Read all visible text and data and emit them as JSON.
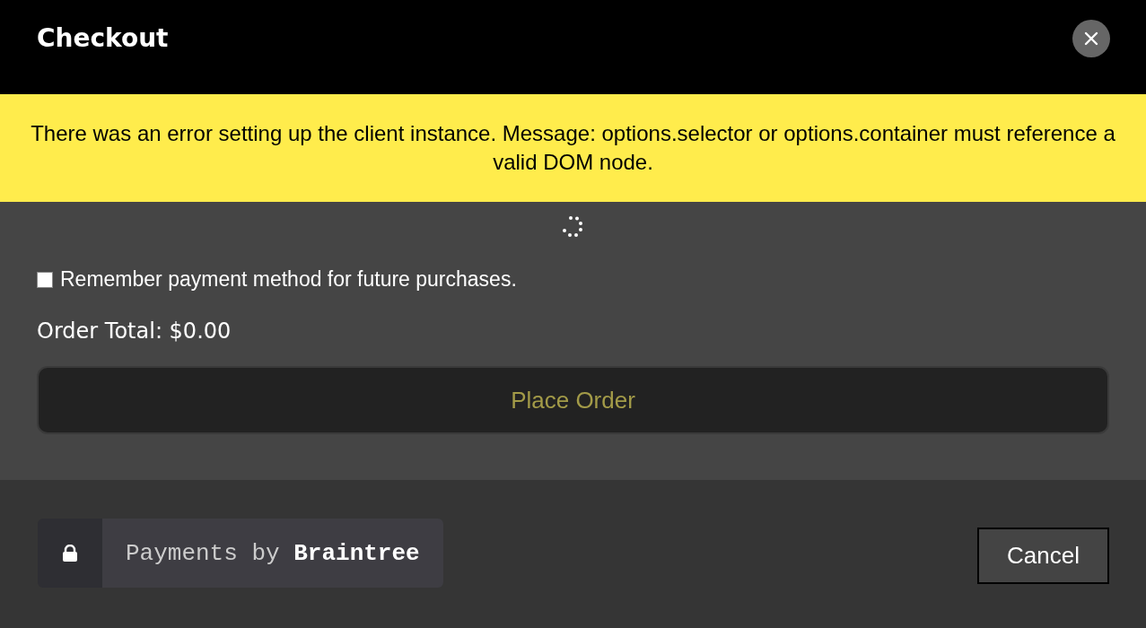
{
  "window": {
    "title": "Checkout"
  },
  "alert": {
    "message": "There was an error setting up the client instance. Message: options.selector or options.container must reference a valid DOM node."
  },
  "remember": {
    "label": "Remember payment method for future purchases.",
    "checked": false
  },
  "order_total": "Order Total: $0.00",
  "place_order": {
    "label": "Place Order",
    "disabled": true
  },
  "badge": {
    "text": "Payments by **Braintree**"
  },
  "cancel": {
    "label": "Cancel"
  }
}
